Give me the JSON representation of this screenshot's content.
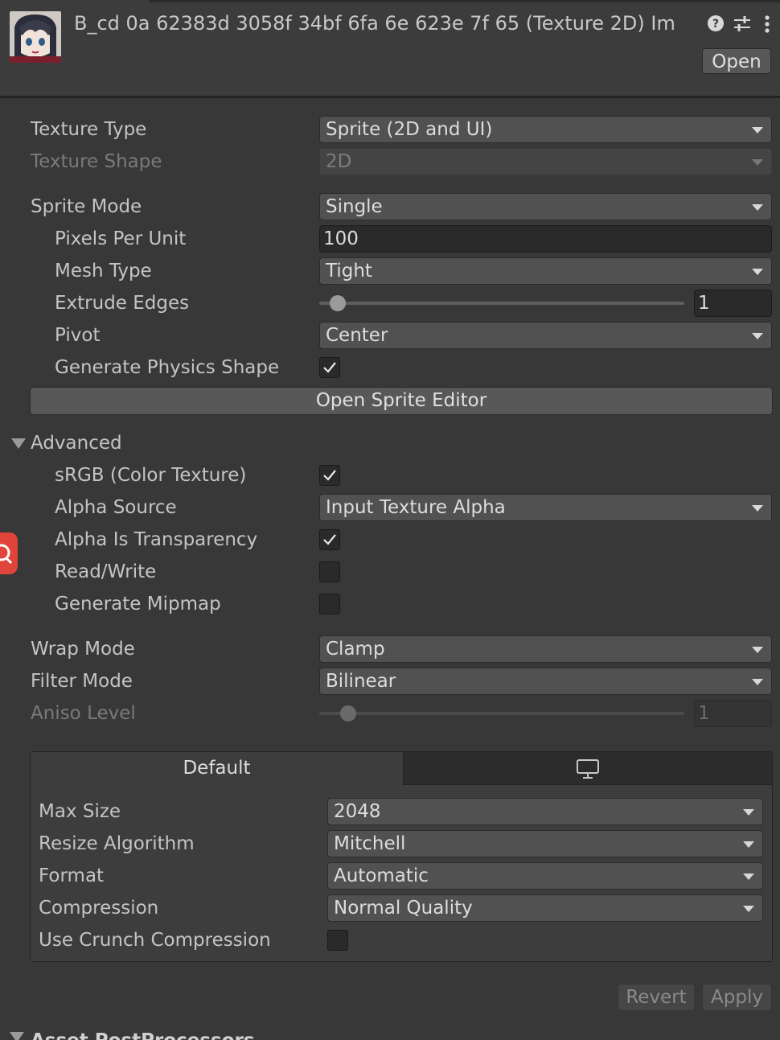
{
  "header": {
    "title": "B_cd 0a 62383d 3058f 34bf 6fa 6e 623e 7f 65 (Texture 2D) Im",
    "open_label": "Open",
    "icons": [
      "help-icon",
      "preset-sliders-icon",
      "kebab-menu-icon"
    ]
  },
  "fields": {
    "texture_type": {
      "label": "Texture Type",
      "value": "Sprite (2D and UI)"
    },
    "texture_shape": {
      "label": "Texture Shape",
      "value": "2D"
    },
    "sprite_mode": {
      "label": "Sprite Mode",
      "value": "Single"
    },
    "pixels_per_unit": {
      "label": "Pixels Per Unit",
      "value": "100"
    },
    "mesh_type": {
      "label": "Mesh Type",
      "value": "Tight"
    },
    "extrude_edges": {
      "label": "Extrude Edges",
      "value": "1",
      "slider_fraction": 0.03
    },
    "pivot": {
      "label": "Pivot",
      "value": "Center"
    },
    "generate_physics_shape": {
      "label": "Generate Physics Shape",
      "checked": true
    },
    "open_sprite_editor": "Open Sprite Editor",
    "advanced": "Advanced",
    "srgb": {
      "label": "sRGB (Color Texture)",
      "checked": true
    },
    "alpha_source": {
      "label": "Alpha Source",
      "value": "Input Texture Alpha"
    },
    "alpha_is_transparency": {
      "label": "Alpha Is Transparency",
      "checked": true
    },
    "read_write": {
      "label": "Read/Write",
      "checked": false
    },
    "generate_mipmap": {
      "label": "Generate Mipmap",
      "checked": false
    },
    "wrap_mode": {
      "label": "Wrap Mode",
      "value": "Clamp"
    },
    "filter_mode": {
      "label": "Filter Mode",
      "value": "Bilinear"
    },
    "aniso_level": {
      "label": "Aniso Level",
      "value": "1",
      "slider_fraction": 0.07
    }
  },
  "platform": {
    "tab_default": "Default",
    "tab_standalone_icon": "monitor-icon",
    "max_size": {
      "label": "Max Size",
      "value": "2048"
    },
    "resize_algorithm": {
      "label": "Resize Algorithm",
      "value": "Mitchell"
    },
    "format": {
      "label": "Format",
      "value": "Automatic"
    },
    "compression": {
      "label": "Compression",
      "value": "Normal Quality"
    },
    "use_crunch": {
      "label": "Use Crunch Compression",
      "checked": false
    }
  },
  "footer": {
    "revert_label": "Revert",
    "apply_label": "Apply"
  },
  "next_section": "Asset PostProcessors",
  "colors": {
    "background": "#383838",
    "header": "#3c3c3c",
    "dropdown": "#515151",
    "button": "#585858",
    "side_badge": "#e0443a"
  }
}
